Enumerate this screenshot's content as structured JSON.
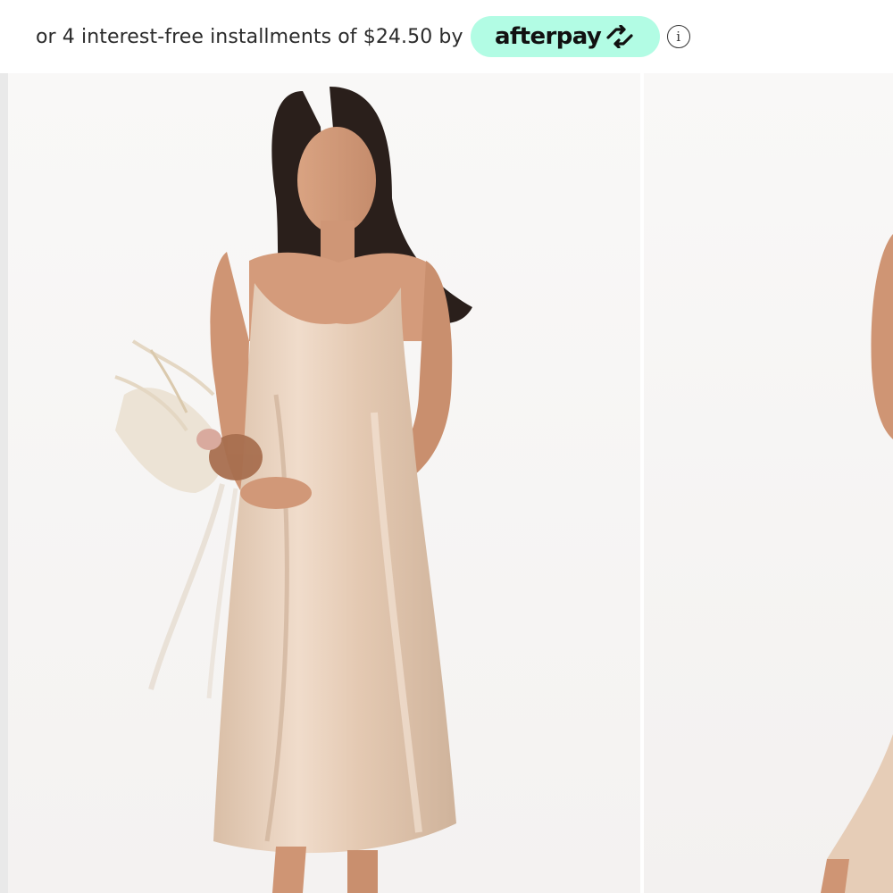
{
  "installments": {
    "text": "or 4 interest-free installments of $24.50 by",
    "provider": "afterpay",
    "provider_icon": "afterpay-arrows-icon",
    "info_icon": "info-icon",
    "info_glyph": "i",
    "badge_color": "#b2fce4"
  },
  "gallery": {
    "images": [
      {
        "subject": "model-in-champagne-satin-slip-dress",
        "icon": "product-photo"
      },
      {
        "subject": "model-in-champagne-satin-slip-dress-alt-view",
        "icon": "product-photo"
      }
    ],
    "dress_color": "#e6cdb7"
  }
}
